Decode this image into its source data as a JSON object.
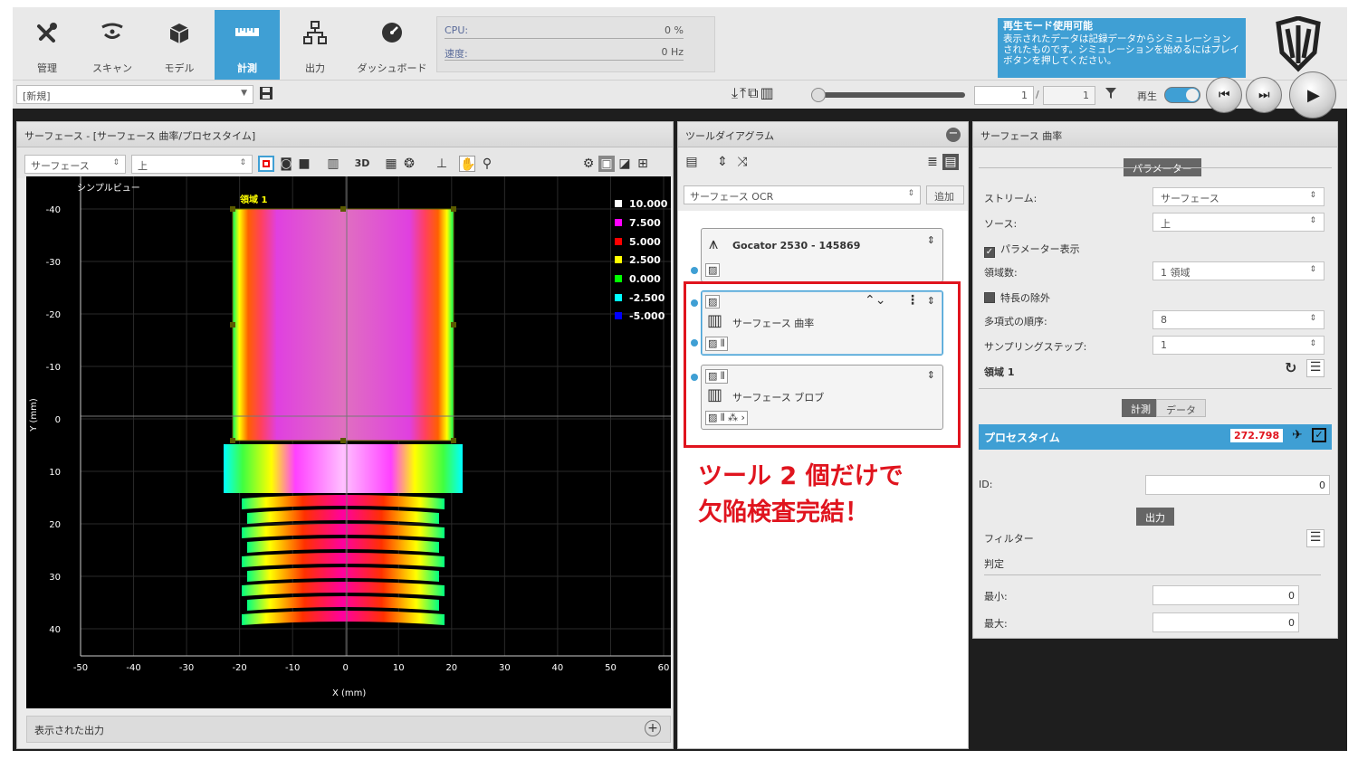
{
  "toolbar": {
    "tabs": [
      {
        "label": "管理",
        "icon": "tools-icon"
      },
      {
        "label": "スキャン",
        "icon": "scan-icon"
      },
      {
        "label": "モデル",
        "icon": "model-icon"
      },
      {
        "label": "計測",
        "icon": "measure-icon",
        "active": true
      },
      {
        "label": "出力",
        "icon": "output-icon"
      },
      {
        "label": "ダッシュボード",
        "icon": "dashboard-icon"
      }
    ],
    "cpu_label": "CPU:",
    "cpu_value": "0 %",
    "speed_label": "速度:",
    "speed_value": "0 Hz"
  },
  "banner": {
    "title": "再生モード使用可能",
    "text": "表示されたデータは記録データからシミュレーションされたものです。シミュレーションを始めるにはプレイボタンを押してください。"
  },
  "bar2": {
    "job_select": "[新規]",
    "frame_current": "1",
    "frame_sep": "/",
    "frame_total": "1",
    "play_label": "再生"
  },
  "left_panel": {
    "title": "サーフェース - [サーフェース 曲率/プロセスタイム]",
    "source_select": "サーフェース",
    "view_select": "上",
    "btn_3d": "3D",
    "view_mode": "シンプルビュー",
    "region_label": "領域 1",
    "x_axis_label": "X (mm)",
    "y_axis_label": "Y (mm)",
    "x_ticks": [
      "-50",
      "-40",
      "-30",
      "-20",
      "-10",
      "0",
      "10",
      "20",
      "30",
      "40",
      "50",
      "60"
    ],
    "y_ticks": [
      "-40",
      "-30",
      "-20",
      "-10",
      "0",
      "10",
      "20",
      "30",
      "40"
    ],
    "legend": [
      {
        "value": "10.000",
        "color": "#ffffff"
      },
      {
        "value": "7.500",
        "color": "#ff00ff"
      },
      {
        "value": "5.000",
        "color": "#ff0000"
      },
      {
        "value": "2.500",
        "color": "#ffff00"
      },
      {
        "value": "0.000",
        "color": "#00ff00"
      },
      {
        "value": "-2.500",
        "color": "#00ffff"
      },
      {
        "value": "-5.000",
        "color": "#0000ff"
      }
    ],
    "footer": "表示された出力"
  },
  "mid_panel": {
    "title": "ツールダイアグラム",
    "tool_select": "サーフェース OCR",
    "add_button": "追加",
    "sensor_node": "Gocator 2530 - 145869",
    "tool1": "サーフェース 曲率",
    "tool2": "サーフェース ブロブ",
    "annotation_line1": "ツール 2 個だけで",
    "annotation_line2": "欠陥検査完結！"
  },
  "right_panel": {
    "title": "サーフェース 曲率",
    "params_tab": "パラメーター",
    "stream_label": "ストリーム:",
    "stream_value": "サーフェース",
    "source_label": "ソース:",
    "source_value": "上",
    "show_params": "パラメーター表示",
    "regions_label": "領域数:",
    "regions_value": "1 領域",
    "exclude_label": "特長の除外",
    "poly_label": "多項式の順序:",
    "poly_value": "8",
    "step_label": "サンプリングステップ:",
    "step_value": "1",
    "region1": "領域 1",
    "tab_measure": "計測",
    "tab_data": "データ",
    "measure_name": "プロセスタイム",
    "measure_value": "272.798",
    "id_label": "ID:",
    "id_value": "0",
    "output_tab": "出力",
    "filter_label": "フィルター",
    "judge_label": "判定",
    "min_label": "最小:",
    "min_value": "0",
    "max_label": "最大:",
    "max_value": "0"
  }
}
